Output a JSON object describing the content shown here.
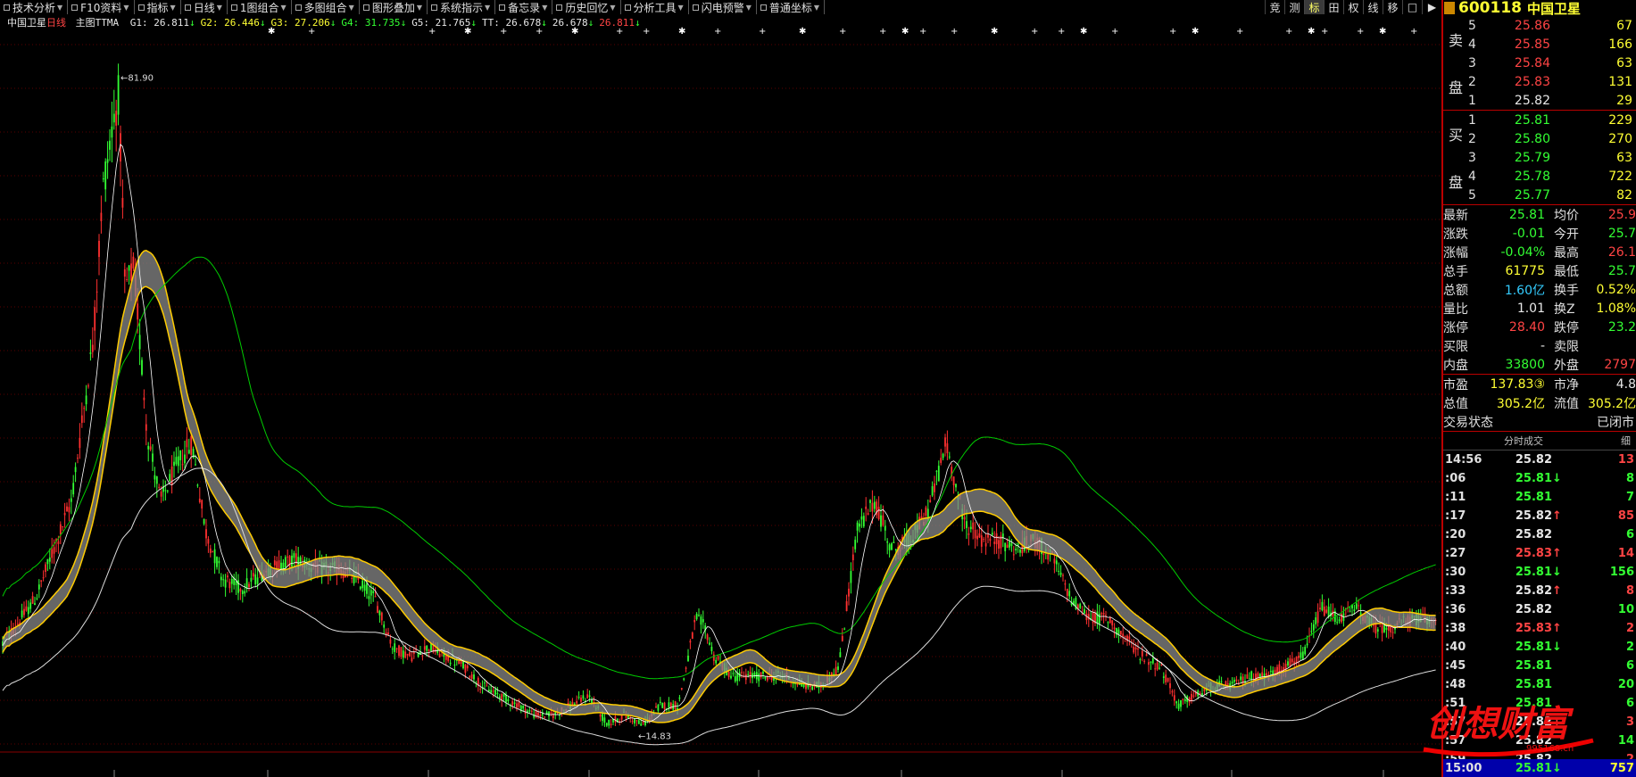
{
  "menu": [
    {
      "label": "技术分析",
      "dd": true
    },
    {
      "label": "F10资料",
      "dd": true
    },
    {
      "label": "指标",
      "dd": true
    },
    {
      "label": "日线",
      "dd": true
    },
    {
      "label": "1图组合",
      "dd": true
    },
    {
      "label": "多图组合",
      "dd": true
    },
    {
      "label": "图形叠加",
      "dd": true
    },
    {
      "label": "系统指示",
      "dd": true
    },
    {
      "label": "备忘录",
      "dd": true
    },
    {
      "label": "历史回忆",
      "dd": true
    },
    {
      "label": "分析工具",
      "dd": true
    },
    {
      "label": "闪电预警",
      "dd": true
    },
    {
      "label": "普通坐标",
      "dd": true
    }
  ],
  "right_tools": [
    "竞",
    "测",
    "标",
    "田",
    "权",
    "线",
    "移",
    "□",
    "▶"
  ],
  "indicator": {
    "stock": "中国卫星",
    "period": "日线",
    "name": "主图TTMA",
    "items": [
      {
        "label": "G1: 26.811",
        "arrow": "↓",
        "color": "#e8e8e8"
      },
      {
        "label": "G2: 26.446",
        "arrow": "↓",
        "color": "#ffff33"
      },
      {
        "label": "G3: 27.206",
        "arrow": "↓",
        "color": "#ffff33"
      },
      {
        "label": "G4: 31.735",
        "arrow": "↓",
        "color": "#33ff33"
      },
      {
        "label": "G5: 21.765",
        "arrow": "↓",
        "color": "#e8e8e8"
      },
      {
        "label": "TT: 26.678",
        "arrow": "↓",
        "color": "#e8e8e8"
      },
      {
        "label": "26.678",
        "arrow": "↓",
        "color": "#e8e8e8"
      },
      {
        "label": "26.811",
        "arrow": "↓",
        "color": "#ff4444"
      }
    ]
  },
  "chart_data": {
    "type": "candlestick",
    "title": "中国卫星 日线",
    "high_label": "81.90",
    "low_label": "14.83",
    "ylim": [
      12,
      85
    ],
    "price_path": [
      [
        0,
        23
      ],
      [
        40,
        28
      ],
      [
        80,
        38
      ],
      [
        105,
        55
      ],
      [
        115,
        70
      ],
      [
        125,
        76
      ],
      [
        133,
        80
      ],
      [
        140,
        60
      ],
      [
        150,
        62
      ],
      [
        165,
        45
      ],
      [
        180,
        38
      ],
      [
        200,
        42
      ],
      [
        215,
        44
      ],
      [
        230,
        35
      ],
      [
        250,
        30
      ],
      [
        270,
        29
      ],
      [
        300,
        31
      ],
      [
        330,
        32
      ],
      [
        360,
        31
      ],
      [
        380,
        31
      ],
      [
        400,
        30
      ],
      [
        420,
        28
      ],
      [
        440,
        23
      ],
      [
        460,
        22
      ],
      [
        480,
        23
      ],
      [
        500,
        22
      ],
      [
        520,
        21
      ],
      [
        540,
        19
      ],
      [
        560,
        18
      ],
      [
        580,
        17
      ],
      [
        600,
        16
      ],
      [
        620,
        16
      ],
      [
        640,
        17
      ],
      [
        660,
        18
      ],
      [
        680,
        15
      ],
      [
        700,
        16
      ],
      [
        720,
        15
      ],
      [
        740,
        17
      ],
      [
        760,
        17
      ],
      [
        780,
        26
      ],
      [
        790,
        25
      ],
      [
        800,
        22
      ],
      [
        820,
        20
      ],
      [
        840,
        20
      ],
      [
        860,
        20
      ],
      [
        880,
        20
      ],
      [
        900,
        19
      ],
      [
        920,
        19
      ],
      [
        940,
        21
      ],
      [
        960,
        35
      ],
      [
        980,
        38
      ],
      [
        1000,
        33
      ],
      [
        1020,
        34
      ],
      [
        1040,
        37
      ],
      [
        1060,
        44
      ],
      [
        1080,
        36
      ],
      [
        1100,
        34
      ],
      [
        1120,
        34
      ],
      [
        1140,
        33
      ],
      [
        1160,
        34
      ],
      [
        1180,
        32
      ],
      [
        1200,
        28
      ],
      [
        1220,
        26
      ],
      [
        1240,
        26
      ],
      [
        1260,
        24
      ],
      [
        1280,
        22
      ],
      [
        1300,
        21
      ],
      [
        1320,
        17
      ],
      [
        1340,
        18
      ],
      [
        1360,
        19
      ],
      [
        1380,
        19
      ],
      [
        1400,
        20
      ],
      [
        1420,
        20
      ],
      [
        1440,
        21
      ],
      [
        1460,
        22
      ],
      [
        1480,
        27
      ],
      [
        1500,
        26
      ],
      [
        1520,
        27
      ],
      [
        1540,
        25
      ],
      [
        1560,
        25
      ],
      [
        1580,
        25.8
      ],
      [
        1610,
        25.8
      ]
    ],
    "annotations": [
      "81.90",
      "14.83"
    ]
  },
  "panel": {
    "code": "600118",
    "name": "中国卫星",
    "sell_label": [
      "卖",
      "盘"
    ],
    "buy_label": [
      "买",
      "盘"
    ],
    "asks": [
      {
        "lv": "5",
        "price": "25.86",
        "vol": "67"
      },
      {
        "lv": "4",
        "price": "25.85",
        "vol": "166"
      },
      {
        "lv": "3",
        "price": "25.84",
        "vol": "63"
      },
      {
        "lv": "2",
        "price": "25.83",
        "vol": "131"
      },
      {
        "lv": "1",
        "price": "25.82",
        "vol": "29"
      }
    ],
    "bids": [
      {
        "lv": "1",
        "price": "25.81",
        "vol": "229"
      },
      {
        "lv": "2",
        "price": "25.80",
        "vol": "270"
      },
      {
        "lv": "3",
        "price": "25.79",
        "vol": "63"
      },
      {
        "lv": "4",
        "price": "25.78",
        "vol": "722"
      },
      {
        "lv": "5",
        "price": "25.77",
        "vol": "82"
      }
    ],
    "quote": [
      {
        "k": "最新",
        "v": "25.81",
        "vc": "green",
        "k2": "均价",
        "v2": "25.9",
        "v2c": "red"
      },
      {
        "k": "涨跌",
        "v": "-0.01",
        "vc": "green",
        "k2": "今开",
        "v2": "25.7",
        "v2c": "green"
      },
      {
        "k": "涨幅",
        "v": "-0.04%",
        "vc": "green",
        "k2": "最高",
        "v2": "26.1",
        "v2c": "red"
      },
      {
        "k": "总手",
        "v": "61775",
        "vc": "yellow",
        "k2": "最低",
        "v2": "25.7",
        "v2c": "green"
      },
      {
        "k": "总额",
        "v": "1.60亿",
        "vc": "cyan",
        "k2": "换手",
        "v2": "0.52%",
        "v2c": "yellow"
      },
      {
        "k": "量比",
        "v": "1.01",
        "vc": "white",
        "k2": "换Z",
        "v2": "1.08%",
        "v2c": "yellow"
      },
      {
        "k": "涨停",
        "v": "28.40",
        "vc": "red",
        "k2": "跌停",
        "v2": "23.2",
        "v2c": "green"
      },
      {
        "k": "买限",
        "v": "-",
        "vc": "white",
        "k2": "卖限",
        "v2": "",
        "v2c": "white"
      },
      {
        "k": "内盘",
        "v": "33800",
        "vc": "green",
        "k2": "外盘",
        "v2": "2797",
        "v2c": "red"
      }
    ],
    "quote2": [
      {
        "k": "市盈",
        "v": "137.83③",
        "vc": "yellow",
        "k2": "市净",
        "v2": "4.8",
        "v2c": "white"
      },
      {
        "k": "总值",
        "v": "305.2亿",
        "vc": "yellow",
        "k2": "流值",
        "v2": "305.2亿",
        "v2c": "yellow"
      }
    ],
    "trade_status_label": "交易状态",
    "trade_status": "已闭市",
    "ticks_header": "分时成交",
    "ticks_header2": "细",
    "ticks": [
      {
        "t": "14:56",
        "p": "25.82",
        "pc": "white",
        "ar": "",
        "q": "13",
        "qc": "red"
      },
      {
        "t": ":06",
        "p": "25.81",
        "pc": "green",
        "ar": "↓",
        "q": "8",
        "qc": "green"
      },
      {
        "t": ":11",
        "p": "25.81",
        "pc": "green",
        "ar": "",
        "q": "7",
        "qc": "green"
      },
      {
        "t": ":17",
        "p": "25.82",
        "pc": "white",
        "ar": "↑",
        "q": "85",
        "qc": "red"
      },
      {
        "t": ":20",
        "p": "25.82",
        "pc": "white",
        "ar": "",
        "q": "6",
        "qc": "green"
      },
      {
        "t": ":27",
        "p": "25.83",
        "pc": "red",
        "ar": "↑",
        "q": "14",
        "qc": "red"
      },
      {
        "t": ":30",
        "p": "25.81",
        "pc": "green",
        "ar": "↓",
        "q": "156",
        "qc": "green"
      },
      {
        "t": ":33",
        "p": "25.82",
        "pc": "white",
        "ar": "↑",
        "q": "8",
        "qc": "red"
      },
      {
        "t": ":36",
        "p": "25.82",
        "pc": "white",
        "ar": "",
        "q": "10",
        "qc": "green"
      },
      {
        "t": ":38",
        "p": "25.83",
        "pc": "red",
        "ar": "↑",
        "q": "2",
        "qc": "red"
      },
      {
        "t": ":40",
        "p": "25.81",
        "pc": "green",
        "ar": "↓",
        "q": "2",
        "qc": "green"
      },
      {
        "t": ":45",
        "p": "25.81",
        "pc": "green",
        "ar": "",
        "q": "6",
        "qc": "green"
      },
      {
        "t": ":48",
        "p": "25.81",
        "pc": "green",
        "ar": "",
        "q": "20",
        "qc": "green"
      },
      {
        "t": ":51",
        "p": "25.81",
        "pc": "green",
        "ar": "",
        "q": "6",
        "qc": "green"
      },
      {
        "t": ":57",
        "p": "25.82",
        "pc": "white",
        "ar": "↑",
        "q": "3",
        "qc": "red"
      },
      {
        "t": ":57",
        "p": "25.82",
        "pc": "white",
        "ar": "",
        "q": "14",
        "qc": "green"
      },
      {
        "t": ":59",
        "p": "25.82",
        "pc": "white",
        "ar": "",
        "q": "2",
        "qc": "red"
      }
    ],
    "last": {
      "t": "15:00",
      "p": "25.81",
      "ar": "↓",
      "q": "757"
    }
  },
  "watermark": {
    "text": "创想财富",
    "url": "995168.cn"
  }
}
